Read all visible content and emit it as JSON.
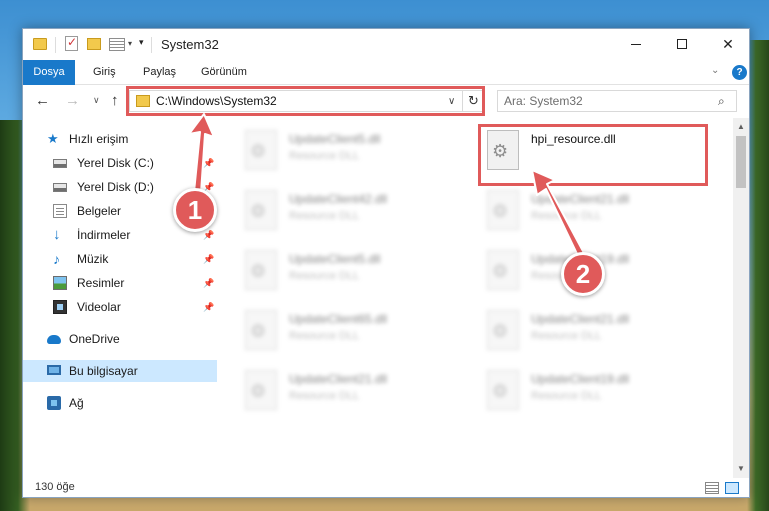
{
  "window": {
    "title": "System32",
    "status": "130 öğe"
  },
  "ribbon": {
    "tabs": [
      "Dosya",
      "Giriş",
      "Paylaş",
      "Görünüm"
    ]
  },
  "address": {
    "path": "C:\\Windows\\System32"
  },
  "search": {
    "placeholder": "Ara: System32"
  },
  "sidebar": {
    "quick_access": "Hızlı erişim",
    "items": [
      {
        "label": "Yerel Disk (C:)",
        "icon": "drive-icon",
        "pinned": true
      },
      {
        "label": "Yerel Disk (D:)",
        "icon": "drive-icon",
        "pinned": true
      },
      {
        "label": "Belgeler",
        "icon": "documents-icon",
        "pinned": true
      },
      {
        "label": "İndirmeler",
        "icon": "download-icon",
        "pinned": true
      },
      {
        "label": "Müzik",
        "icon": "music-icon",
        "pinned": true
      },
      {
        "label": "Resimler",
        "icon": "pictures-icon",
        "pinned": true
      },
      {
        "label": "Videolar",
        "icon": "videos-icon",
        "pinned": true
      }
    ],
    "onedrive": "OneDrive",
    "this_pc": "Bu bilgisayar",
    "network": "Ağ"
  },
  "files": [
    {
      "name": "UpdateClient5.dll",
      "type": "Resource DLL",
      "blurred": true
    },
    {
      "name": "hpi_resource.dll",
      "type": "",
      "blurred": false
    },
    {
      "name": "UpdateClient42.dll",
      "type": "Resource DLL",
      "blurred": true
    },
    {
      "name": "UpdateClient21.dll",
      "type": "Resource DLL",
      "blurred": true
    },
    {
      "name": "UpdateClient5.dll",
      "type": "Resource DLL",
      "blurred": true
    },
    {
      "name": "UpdateClient19.dll",
      "type": "Resource DLL",
      "blurred": true
    },
    {
      "name": "UpdateClient65.dll",
      "type": "Resource DLL",
      "blurred": true
    },
    {
      "name": "UpdateClient21.dll",
      "type": "Resource DLL",
      "blurred": true
    },
    {
      "name": "UpdateClient21.dll",
      "type": "Resource DLL",
      "blurred": true
    },
    {
      "name": "UpdateClient19.dll",
      "type": "Resource DLL",
      "blurred": true
    }
  ],
  "annotations": {
    "step1": "1",
    "step2": "2",
    "color": "#e05a5a"
  },
  "colors": {
    "accent": "#1979ca",
    "selected": "#cce8ff"
  }
}
